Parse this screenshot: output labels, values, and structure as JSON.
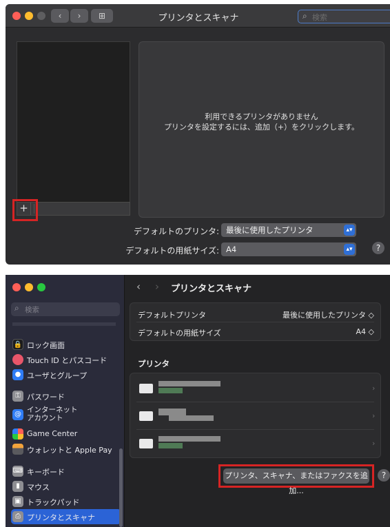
{
  "top_window": {
    "title": "プリンタとスキャナ",
    "search_placeholder": "検索",
    "grid_icon": "⊞",
    "add_button_label": "+",
    "empty_message_1": "利用できるプリンタがありません",
    "empty_message_2": "プリンタを設定するには、追加（+）をクリックします。",
    "default_printer_label": "デフォルトのプリンタ:",
    "default_printer_value": "最後に使用したプリンタ",
    "default_paper_label": "デフォルトの用紙サイズ:",
    "default_paper_value": "A4",
    "help_label": "?"
  },
  "bottom_window": {
    "title": "プリンタとスキャナ",
    "search_placeholder": "検索",
    "sidebar_items": [
      {
        "label": "ロック画面",
        "icon": "lock-screen-icon",
        "color": "#1c1c1e"
      },
      {
        "label": "Touch ID とパスコード",
        "icon": "fingerprint-icon",
        "color": "#e8566a"
      },
      {
        "label": "ユーザとグループ",
        "icon": "users-icon",
        "color": "#2f7cf6"
      },
      {
        "label": "パスワード",
        "icon": "key-icon",
        "color": "#8e8e93"
      },
      {
        "label": "インターネット\nアカウント",
        "icon": "at-icon",
        "color": "#2f7cf6"
      },
      {
        "label": "Game Center",
        "icon": "game-center-icon",
        "color": "#e0e0e0"
      },
      {
        "label": "ウォレットと Apple Pay",
        "icon": "wallet-icon",
        "color": "#5a5a5e"
      },
      {
        "label": "キーボード",
        "icon": "keyboard-icon",
        "color": "#8e8e93"
      },
      {
        "label": "マウス",
        "icon": "mouse-icon",
        "color": "#8e8e93"
      },
      {
        "label": "トラックパッド",
        "icon": "trackpad-icon",
        "color": "#8e8e93"
      },
      {
        "label": "プリンタとスキャナ",
        "icon": "printer-icon",
        "color": "#8e8e93"
      }
    ],
    "default_printer_label": "デフォルトプリンタ",
    "default_printer_value": "最後に使用したプリンタ ◇",
    "default_paper_label": "デフォルトの用紙サイズ",
    "default_paper_value": "A4 ◇",
    "printers_heading": "プリンタ",
    "add_button_label": "プリンタ、スキャナ、またはファクスを追加...",
    "help_label": "?"
  },
  "colors": {
    "highlight": "#d62424",
    "accent": "#2b63d6"
  }
}
